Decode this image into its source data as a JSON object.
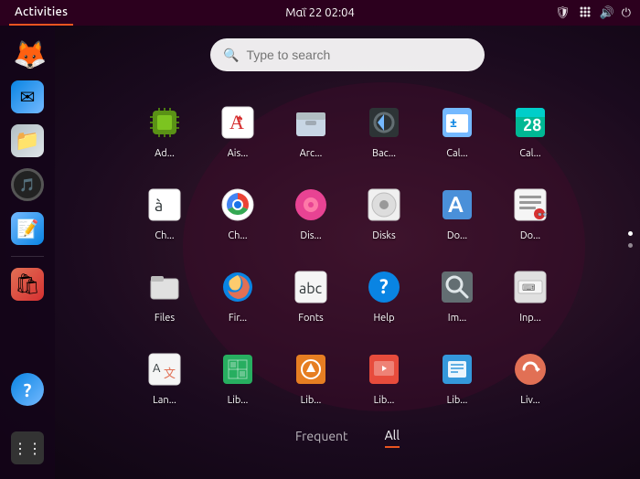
{
  "topbar": {
    "activities": "Activities",
    "datetime": "Μαΐ 22  02:04",
    "icons": {
      "shield": "🛡",
      "network": "⬡",
      "volume": "🔊",
      "power": "⏻"
    }
  },
  "search": {
    "placeholder": "Type to search"
  },
  "tabs": [
    {
      "label": "Frequent",
      "active": false
    },
    {
      "label": "All",
      "active": true
    }
  ],
  "apps": [
    {
      "label": "Ad...",
      "icon": "cpu",
      "color": "icon-cpu",
      "emoji": ""
    },
    {
      "label": "Ais...",
      "icon": "aisleriot",
      "color": "icon-aisleriot",
      "emoji": "🃏"
    },
    {
      "label": "Arc...",
      "icon": "archive",
      "color": "icon-archive",
      "emoji": "📦"
    },
    {
      "label": "Bac...",
      "icon": "backup",
      "color": "icon-backup",
      "emoji": "⬆"
    },
    {
      "label": "Cal...",
      "icon": "calcurse",
      "color": "icon-calcurse",
      "emoji": "±"
    },
    {
      "label": "Cal...",
      "icon": "calendar",
      "color": "icon-calendar",
      "emoji": "28"
    },
    {
      "label": "Ch...",
      "icon": "chars",
      "color": "icon-chars",
      "emoji": "à"
    },
    {
      "label": "Ch...",
      "icon": "chromium",
      "color": "icon-chromium",
      "emoji": "⬤"
    },
    {
      "label": "Dis...",
      "icon": "disks-tool",
      "color": "icon-disks-tool",
      "emoji": "◎"
    },
    {
      "label": "Disks",
      "icon": "disks",
      "color": "icon-disks",
      "emoji": "💿"
    },
    {
      "label": "Do...",
      "icon": "docviewer",
      "color": "icon-docviewer",
      "emoji": "A"
    },
    {
      "label": "Do...",
      "icon": "docreader",
      "color": "icon-docreader",
      "emoji": "📖"
    },
    {
      "label": "Files",
      "icon": "files",
      "color": "icon-files",
      "emoji": "📁"
    },
    {
      "label": "Fir...",
      "icon": "firefox",
      "color": "icon-firefox",
      "emoji": "🔥"
    },
    {
      "label": "Fonts",
      "icon": "fonts",
      "color": "icon-fonts",
      "emoji": "ab"
    },
    {
      "label": "Help",
      "icon": "help",
      "color": "icon-help",
      "emoji": "?"
    },
    {
      "label": "Im...",
      "icon": "imageviewer",
      "color": "icon-imageviewer",
      "emoji": "🔍"
    },
    {
      "label": "Inp...",
      "icon": "input",
      "color": "icon-input",
      "emoji": "⌨"
    },
    {
      "label": "Lan...",
      "icon": "lang",
      "color": "icon-lang",
      "emoji": "A文"
    },
    {
      "label": "Lib...",
      "icon": "libre-calc",
      "color": "icon-libre-calc",
      "emoji": "📊"
    },
    {
      "label": "Lib...",
      "icon": "libre-draw",
      "color": "icon-libre-draw",
      "emoji": "✏"
    },
    {
      "label": "Lib...",
      "icon": "libre-impress",
      "color": "icon-libre-impress",
      "emoji": "📽"
    },
    {
      "label": "Lib...",
      "icon": "libre-writer",
      "color": "icon-libre-writer",
      "emoji": "📄"
    },
    {
      "label": "Liv...",
      "icon": "livepatch",
      "color": "icon-livepatch",
      "emoji": "↺"
    }
  ],
  "sidebar": {
    "items": [
      {
        "name": "firefox",
        "emoji": "🦊"
      },
      {
        "name": "email",
        "emoji": "✉"
      },
      {
        "name": "files",
        "emoji": "📁"
      },
      {
        "name": "rhythmbox",
        "emoji": "🎵"
      },
      {
        "name": "writer",
        "emoji": "📝"
      },
      {
        "name": "appstore",
        "emoji": "🛍"
      }
    ],
    "bottom": [
      {
        "name": "help",
        "emoji": "?"
      }
    ],
    "grid": "⋮⋮⋮"
  }
}
